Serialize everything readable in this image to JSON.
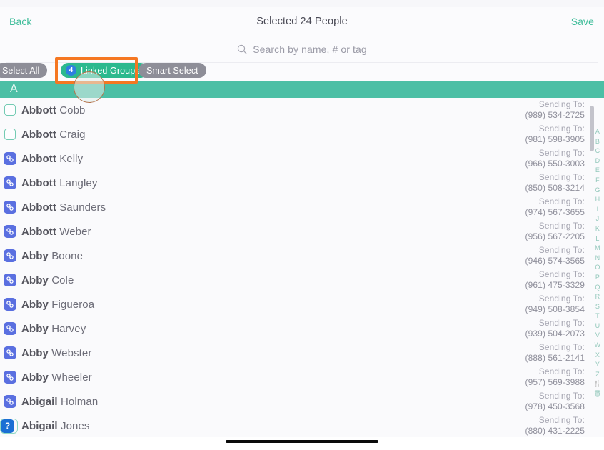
{
  "navbar": {
    "back_label": "Back",
    "title": "Selected 24 People",
    "save_label": "Save"
  },
  "search": {
    "placeholder": "Search by name, # or tag",
    "icon": "search-icon"
  },
  "filters": [
    {
      "label": "Select All",
      "style": "grey",
      "badge": null
    },
    {
      "label": "Linked Groups",
      "style": "green",
      "badge": "4"
    },
    {
      "label": "Smart Select",
      "style": "grey",
      "badge": null
    }
  ],
  "section": {
    "letter": "A"
  },
  "list": {
    "sending_label": "Sending To:",
    "rows": [
      {
        "marker": "checkbox",
        "first": "Abbott",
        "last": "Cobb",
        "sending_to": "(989) 534-2725"
      },
      {
        "marker": "checkbox",
        "first": "Abbott",
        "last": "Craig",
        "sending_to": "(981) 598-3905"
      },
      {
        "marker": "link-icon",
        "first": "Abbott",
        "last": "Kelly",
        "sending_to": "(966) 550-3003"
      },
      {
        "marker": "link-icon",
        "first": "Abbott",
        "last": "Langley",
        "sending_to": "(850) 508-3214"
      },
      {
        "marker": "link-icon",
        "first": "Abbott",
        "last": "Saunders",
        "sending_to": "(974) 567-3655"
      },
      {
        "marker": "link-icon",
        "first": "Abbott",
        "last": "Weber",
        "sending_to": "(956) 567-2205"
      },
      {
        "marker": "link-icon",
        "first": "Abby",
        "last": "Boone",
        "sending_to": "(946) 574-3565"
      },
      {
        "marker": "link-icon",
        "first": "Abby",
        "last": "Cole",
        "sending_to": "(961) 475-3329"
      },
      {
        "marker": "link-icon",
        "first": "Abby",
        "last": "Figueroa",
        "sending_to": "(949) 508-3854"
      },
      {
        "marker": "link-icon",
        "first": "Abby",
        "last": "Harvey",
        "sending_to": "(939) 504-2073"
      },
      {
        "marker": "link-icon",
        "first": "Abby",
        "last": "Webster",
        "sending_to": "(888) 561-2141"
      },
      {
        "marker": "link-icon",
        "first": "Abby",
        "last": "Wheeler",
        "sending_to": "(957) 569-3988"
      },
      {
        "marker": "link-icon",
        "first": "Abigail",
        "last": "Holman",
        "sending_to": "(978) 450-3568"
      },
      {
        "marker": "unknown",
        "first": "Abigail",
        "last": "Jones",
        "sending_to": "(880) 431-2225"
      }
    ]
  },
  "alpha_index": [
    "A",
    "B",
    "C",
    "D",
    "E",
    "F",
    "G",
    "H",
    "I",
    "J",
    "K",
    "L",
    "M",
    "N",
    "O",
    "P",
    "Q",
    "R",
    "S",
    "T",
    "U",
    "V",
    "W",
    "X",
    "Y",
    "Z",
    "🍴",
    "🗑"
  ],
  "annotation": {
    "highlight_target": "Linked Groups",
    "highlight_color": "#f57722",
    "touch_indicator": "tap-circle"
  },
  "colors": {
    "accent_green": "#3fbd9a",
    "section_teal": "#4cbfa5",
    "pill_grey": "#8e8e98",
    "pill_green": "#2cb98e",
    "badge_blue": "#2f7fe0",
    "link_icon_blue": "#5a6fe0",
    "unknown_icon_blue": "#1b6fd4",
    "highlight_orange": "#f57722"
  }
}
